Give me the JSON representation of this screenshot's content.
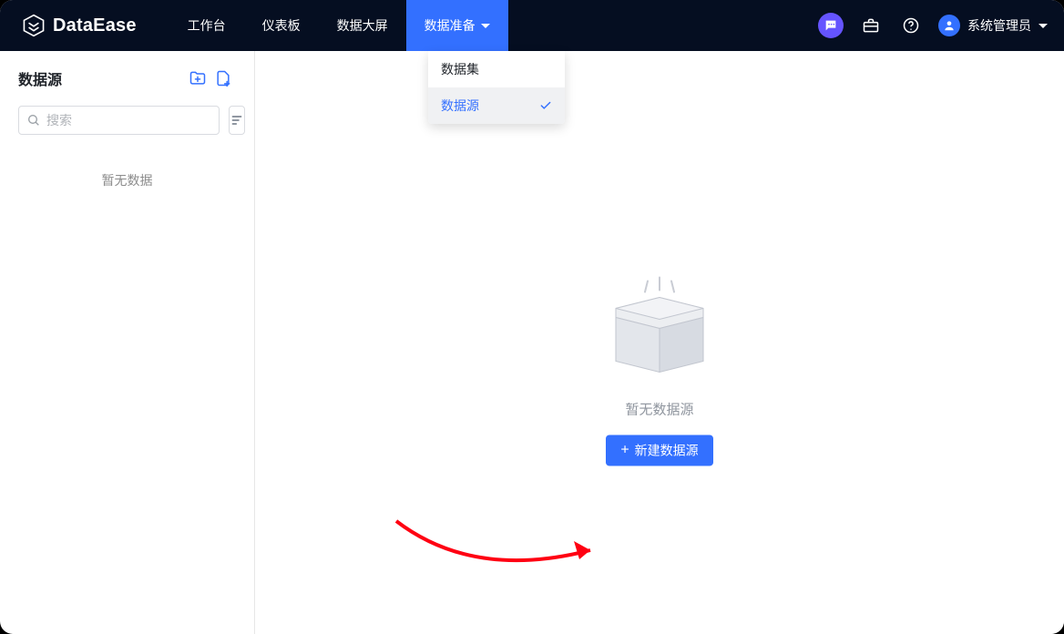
{
  "brand": {
    "name": "DataEase"
  },
  "nav": {
    "items": [
      {
        "label": "工作台"
      },
      {
        "label": "仪表板"
      },
      {
        "label": "数据大屏"
      },
      {
        "label": "数据准备"
      }
    ]
  },
  "nav_dropdown": {
    "items": [
      {
        "label": "数据集"
      },
      {
        "label": "数据源"
      }
    ]
  },
  "user": {
    "name": "系统管理员"
  },
  "sidebar": {
    "title": "数据源",
    "search_placeholder": "搜索",
    "empty_label": "暂无数据"
  },
  "main": {
    "empty_label": "暂无数据源",
    "create_button_label": "新建数据源"
  }
}
